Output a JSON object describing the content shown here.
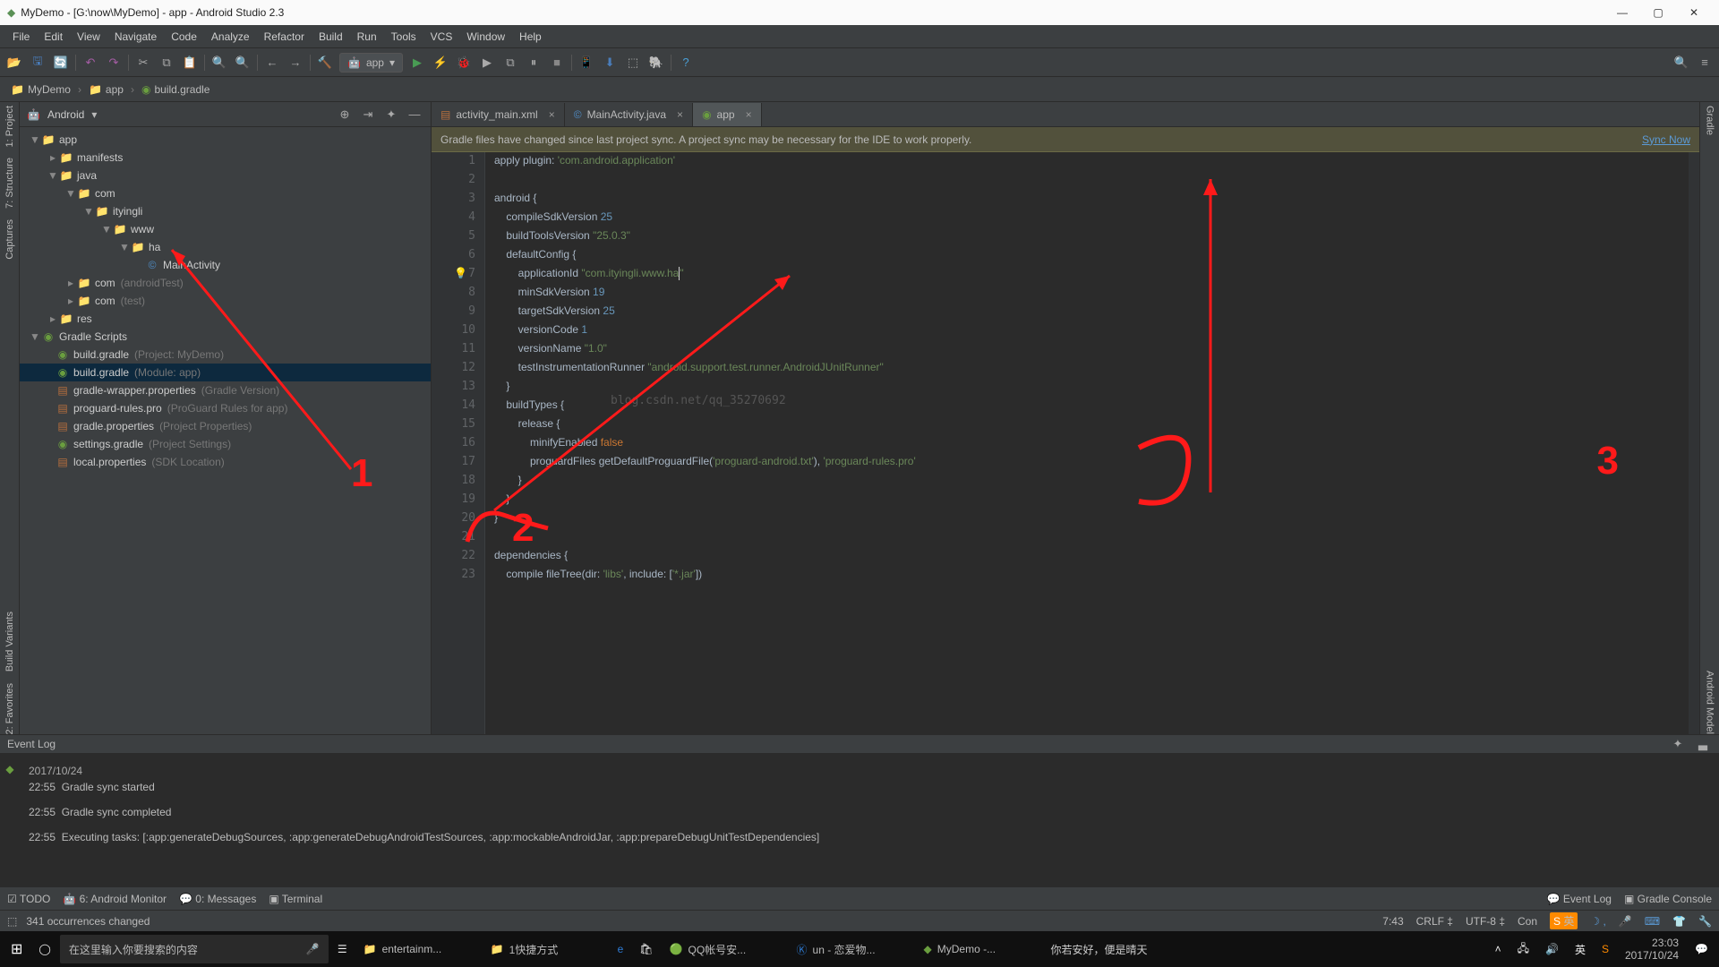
{
  "title": "MyDemo - [G:\\now\\MyDemo] - app - Android Studio 2.3",
  "menu": [
    "File",
    "Edit",
    "View",
    "Navigate",
    "Code",
    "Analyze",
    "Refactor",
    "Build",
    "Run",
    "Tools",
    "VCS",
    "Window",
    "Help"
  ],
  "runconfig": "app",
  "crumb": {
    "a": "MyDemo",
    "b": "app",
    "c": "build.gradle"
  },
  "projselector": "Android",
  "tree": {
    "app": "app",
    "manifests": "manifests",
    "java": "java",
    "com": "com",
    "ityingli": "ityingli",
    "www": "www",
    "ha": "ha",
    "mainact": "MainActivity",
    "com_at": "com",
    "com_at_hint": "(androidTest)",
    "com_t": "com",
    "com_t_hint": "(test)",
    "res": "res",
    "gs": "Gradle Scripts",
    "bg1": "build.gradle",
    "bg1h": "(Project: MyDemo)",
    "bg2": "build.gradle",
    "bg2h": "(Module: app)",
    "gwp": "gradle-wrapper.properties",
    "gwph": "(Gradle Version)",
    "pgr": "proguard-rules.pro",
    "pgrh": "(ProGuard Rules for app)",
    "gp": "gradle.properties",
    "gph": "(Project Properties)",
    "sg": "settings.gradle",
    "sgh": "(Project Settings)",
    "lp": "local.properties",
    "lph": "(SDK Location)"
  },
  "tabs": {
    "t1": "activity_main.xml",
    "t2": "MainActivity.java",
    "t3": "app"
  },
  "notif": {
    "msg": "Gradle files have changed since last project sync. A project sync may be necessary for the IDE to work properly.",
    "link": "Sync Now"
  },
  "code": {
    "l1a": "apply",
    "l1b": " plugin: ",
    "l1c": "'com.android.application'",
    "l3": "android {",
    "l4a": "    compileSdkVersion ",
    "l4b": "25",
    "l5a": "    buildToolsVersion ",
    "l5b": "\"25.0.3\"",
    "l6": "    defaultConfig {",
    "l7a": "        applicationId ",
    "l7b": "\"com.ityingli.www.ha",
    "l7c": "\"",
    "l8a": "        minSdkVersion ",
    "l8b": "19",
    "l9a": "        targetSdkVersion ",
    "l9b": "25",
    "l10a": "        versionCode ",
    "l10b": "1",
    "l11a": "        versionName ",
    "l11b": "\"1.0\"",
    "l12a": "        testInstrumentationRunner ",
    "l12b": "\"android.support.test.runner.AndroidJUnitRunner\"",
    "l13": "    }",
    "l14": "    buildTypes {",
    "l15": "        release {",
    "l16a": "            minifyEnabled ",
    "l16b": "false",
    "l17a": "            proguardFiles getDefaultProguardFile(",
    "l17b": "'proguard-android.txt'",
    "l17c": "), ",
    "l17d": "'proguard-rules.pro'",
    "l18": "        }",
    "l19": "    }",
    "l20": "}",
    "l22": "dependencies {",
    "l23a": "    compile fileTree(dir: ",
    "l23b": "'libs'",
    "l23c": ", include: [",
    "l23d": "'*.jar'",
    "l23e": "])"
  },
  "watermark": "blog.csdn.net/qq_35270692",
  "eventlog": {
    "title": "Event Log",
    "date": "2017/10/24",
    "e1t": "22:55",
    "e1": "Gradle sync started",
    "e2t": "22:55",
    "e2": "Gradle sync completed",
    "e3t": "22:55",
    "e3": "Executing tasks: [:app:generateDebugSources, :app:generateDebugAndroidTestSources, :app:mockableAndroidJar, :app:prepareDebugUnitTestDependencies]"
  },
  "toolwin": {
    "todo": "TODO",
    "am": "6: Android Monitor",
    "msg": "0: Messages",
    "term": "Terminal",
    "evlog": "Event Log",
    "gc": "Gradle Console"
  },
  "status": {
    "msg": "341 occurrences changed",
    "pos": "7:43",
    "crlf": "CRLF",
    "enc": "UTF-8",
    "ctx": "Con"
  },
  "sidetool": {
    "proj": "1: Project",
    "struct": "7: Structure",
    "capt": "Captures",
    "bv": "Build Variants",
    "fav": "2: Favorites",
    "gradle": "Gradle",
    "am": "Android Model"
  },
  "taskbar": {
    "search": "在这里输入你要搜索的内容",
    "t1": "entertainm...",
    "t2": "1快捷方式",
    "t3": "QQ帐号安...",
    "t4": "un - 恋爱物...",
    "t5": "MyDemo -...",
    "q": "你若安好，便是晴天",
    "time": "23:03",
    "date": "2017/10/24",
    "ime": "英"
  },
  "anno": {
    "n1": "1",
    "n2": "2",
    "n3": "3"
  }
}
